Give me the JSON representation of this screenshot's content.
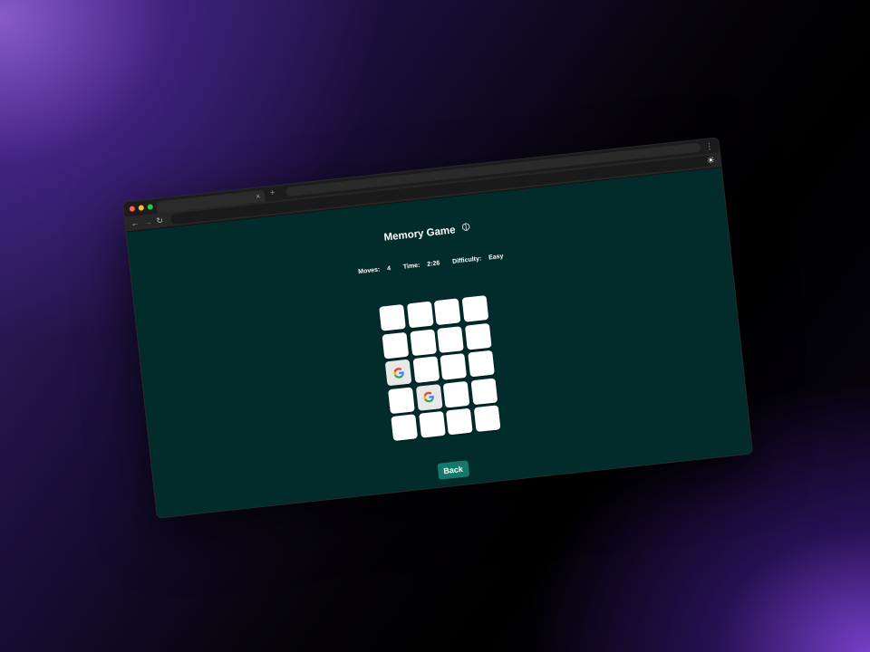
{
  "browser": {
    "tab_close": "×",
    "new_tab": "+",
    "menu": "⋮",
    "nav_back": "←",
    "nav_forward": "→",
    "nav_reload": "↻"
  },
  "theme_toggle_icon": "☀",
  "game": {
    "title": "Memory Game",
    "title_icon": "brain-icon",
    "stats": {
      "moves_label": "Moves:",
      "moves": "4",
      "time_label": "Time:",
      "time": "2:26",
      "difficulty_label": "Difficulty:",
      "difficulty": "Easy"
    },
    "grid": {
      "columns": 4,
      "rows": 5
    },
    "cards": [
      {
        "state": "hidden"
      },
      {
        "state": "hidden"
      },
      {
        "state": "hidden"
      },
      {
        "state": "hidden"
      },
      {
        "state": "hidden"
      },
      {
        "state": "hidden"
      },
      {
        "state": "hidden"
      },
      {
        "state": "hidden"
      },
      {
        "state": "revealed",
        "icon": "google-icon"
      },
      {
        "state": "hidden"
      },
      {
        "state": "hidden"
      },
      {
        "state": "hidden"
      },
      {
        "state": "hidden"
      },
      {
        "state": "revealed",
        "icon": "google-icon"
      },
      {
        "state": "hidden"
      },
      {
        "state": "hidden"
      },
      {
        "state": "hidden"
      },
      {
        "state": "hidden"
      },
      {
        "state": "hidden"
      },
      {
        "state": "hidden"
      }
    ],
    "back_label": "Back"
  },
  "colors": {
    "page_background": "#022c2b",
    "button": "#137a6b",
    "card": "#ffffff"
  }
}
